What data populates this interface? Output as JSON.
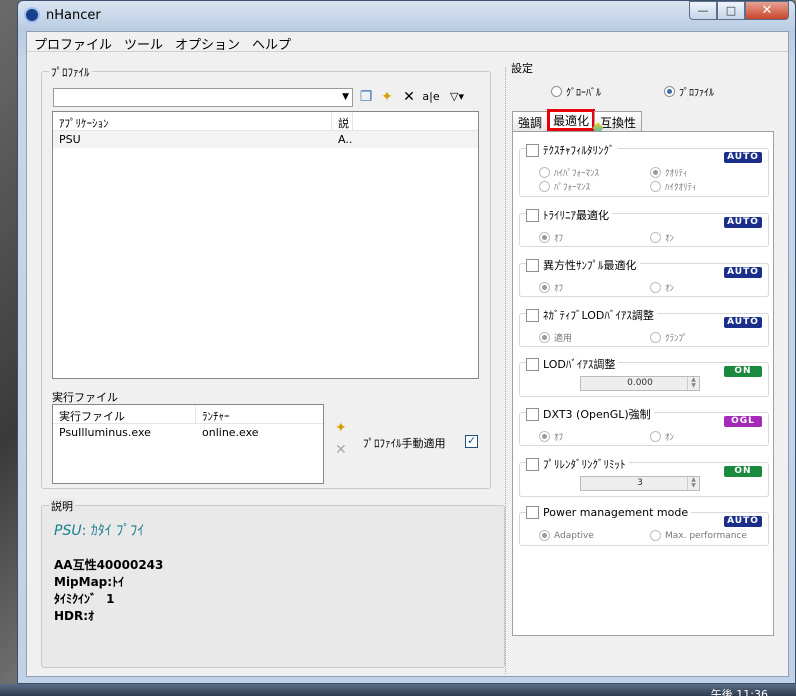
{
  "window": {
    "title": "nHancer",
    "minimize": "—",
    "maximize": "□",
    "close": "✕"
  },
  "menu": [
    "プロファイル",
    "ツール",
    "オプション",
    "ヘルプ"
  ],
  "left": {
    "profile_group": "ﾌﾟﾛﾌｧｲﾙ",
    "toolbar_icons": [
      "copy-icon",
      "new-icon",
      "delete-icon",
      "rename-icon",
      "filter-icon"
    ],
    "rename_glyph": "a|e",
    "columns": [
      "ｱﾌﾟﾘｹｰｼｮﾝ",
      "説"
    ],
    "rows": [
      {
        "app": "PSU",
        "desc": "A.."
      }
    ],
    "exe_group": "実行ファイル",
    "exe_columns": [
      "実行ファイル",
      "ﾗﾝﾁｬｰ"
    ],
    "exe_rows": [
      {
        "exe": "PsuIlluminus.exe",
        "launcher": "online.exe"
      }
    ],
    "manual_apply": "ﾌﾟﾛﾌｧｲﾙ手動適用",
    "manual_apply_checked": true
  },
  "description": {
    "label": "説明",
    "title_name": "PSU",
    "title_rest": ": ｶﾀｲ ﾌﾟﾌｲ",
    "lines": [
      "AA互性40000243",
      "MipMap:ﾄｲ",
      "ﾀｲﾐｸｲﾝ゛ 1",
      "HDR:ｵ"
    ]
  },
  "settings": {
    "label": "設定",
    "scope": [
      {
        "label": "ｸﾞﾛｰﾊﾞﾙ",
        "selected": false
      },
      {
        "label": "ﾌﾟﾛﾌｧｲﾙ",
        "selected": true
      }
    ],
    "tabs": [
      "強調",
      "最適化",
      "互換性"
    ],
    "active_tab": "最適化",
    "groups": [
      {
        "title": "ﾃｸｽﾁｬﾌｨﾙﾀﾘﾝｸﾞ",
        "badge": "AUTO",
        "badge_type": "auto",
        "options": [
          "ﾊｲﾊﾟﾌｫｰﾏﾝｽ",
          "ｸｵﾘﾃｨ",
          "ﾊﾟﾌｫｰﾏﾝｽ",
          "ﾊｲｸｵﾘﾃｨ"
        ],
        "selected": "ｸｵﾘﾃｨ"
      },
      {
        "title": "ﾄﾗｲﾘﾆｱ最適化",
        "badge": "AUTO",
        "badge_type": "auto",
        "options": [
          "ｵﾌ",
          "ｵﾝ"
        ],
        "selected": "ｵﾌ"
      },
      {
        "title": "異方性ｻﾝﾌﾟﾙ最適化",
        "badge": "AUTO",
        "badge_type": "auto",
        "options": [
          "ｵﾌ",
          "ｵﾝ"
        ],
        "selected": "ｵﾌ"
      },
      {
        "title": "ﾈｶﾞﾃｨﾌﾞLODﾊﾞｲｱｽ調整",
        "badge": "AUTO",
        "badge_type": "auto",
        "options": [
          "適用",
          "ｸﾗﾝﾌﾟ"
        ],
        "selected": "適用"
      },
      {
        "title": "LODﾊﾞｲｱｽ調整",
        "badge": "ON",
        "badge_type": "on",
        "value": "0.000"
      },
      {
        "title": "DXT3 (OpenGL)強制",
        "badge": "OGL",
        "badge_type": "ogl",
        "options": [
          "ｵﾌ",
          "ｵﾝ"
        ],
        "selected": "ｵﾌ"
      },
      {
        "title": "ﾌﾟﾘﾚﾝﾀﾞﾘﾝｸﾞﾘﾐｯﾄ",
        "badge": "ON",
        "badge_type": "on",
        "value": "3"
      },
      {
        "title": "Power management mode",
        "badge": "AUTO",
        "badge_type": "auto",
        "options": [
          "Adaptive",
          "Max. performance"
        ],
        "selected": "Adaptive"
      }
    ]
  },
  "taskbar": {
    "time": "午後 11:36"
  }
}
